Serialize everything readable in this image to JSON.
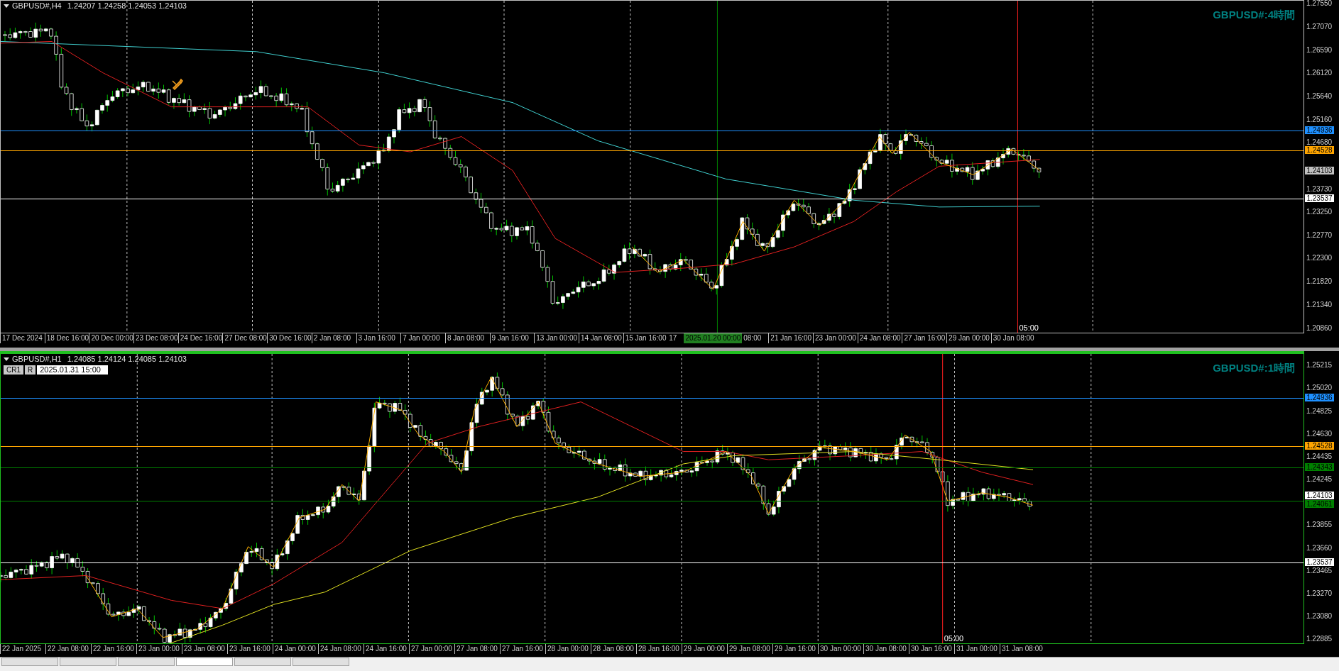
{
  "charts": [
    {
      "kind": "h4",
      "active": false,
      "header": {
        "symbol": "GBPUSD#,H4",
        "quotes": "1.24207 1.24258 1.24053 1.24103"
      },
      "title": "GBPUSD#:4時間",
      "price_ticks": [
        "1.27550",
        "1.27070",
        "1.26590",
        "1.26120",
        "1.25640",
        "1.25160",
        "1.24680",
        "1.23730",
        "1.23250",
        "1.22770",
        "1.22300",
        "1.21820",
        "1.21340",
        "1.20860"
      ],
      "price_lines": [
        {
          "price": "1.24936",
          "kind": "level",
          "color": "#1e90ff"
        },
        {
          "price": "1.24528",
          "kind": "level",
          "color": "#ffa500"
        },
        {
          "price": "1.24103",
          "kind": "bid",
          "color": "#c0c0c0"
        },
        {
          "price": "1.23537",
          "kind": "level",
          "color": "#ffffff"
        }
      ],
      "time_labels": [
        {
          "text": "17 Dec 2024",
          "kind": "tick"
        },
        {
          "text": "18 Dec 16:00",
          "kind": "tick"
        },
        {
          "text": "20 Dec 00:00",
          "kind": "tick"
        },
        {
          "text": "23 Dec 08:00",
          "kind": "tick"
        },
        {
          "text": "24 Dec 16:00",
          "kind": "tick"
        },
        {
          "text": "27 Dec 08:00",
          "kind": "tick"
        },
        {
          "text": "30 Dec 16:00",
          "kind": "tick"
        },
        {
          "text": "2 Jan 08:00",
          "kind": "tick"
        },
        {
          "text": "3 Jan 16:00",
          "kind": "tick"
        },
        {
          "text": "7 Jan 00:00",
          "kind": "tick"
        },
        {
          "text": "8 Jan 08:00",
          "kind": "tick"
        },
        {
          "text": "9 Jan 16:00",
          "kind": "tick"
        },
        {
          "text": "13 Jan 00:00",
          "kind": "tick"
        },
        {
          "text": "14 Jan 08:00",
          "kind": "tick"
        },
        {
          "text": "15 Jan 16:00",
          "kind": "tick"
        },
        {
          "text": "17",
          "kind": "partial"
        },
        {
          "text": "2025.01.20 00:00",
          "kind": "cursor"
        },
        {
          "text": "08:00",
          "kind": "partial"
        },
        {
          "text": "21 Jan 16:00",
          "kind": "tick"
        },
        {
          "text": "23 Jan 00:00",
          "kind": "tick"
        },
        {
          "text": "24 Jan 08:00",
          "kind": "tick"
        },
        {
          "text": "27 Jan 16:00",
          "kind": "tick"
        },
        {
          "text": "29 Jan 00:00",
          "kind": "tick"
        },
        {
          "text": "30 Jan 08:00",
          "kind": "tick"
        }
      ],
      "marker_time": "05:00"
    },
    {
      "kind": "h1",
      "active": true,
      "header": {
        "symbol": "GBPUSD#,H1",
        "quotes": "1.24085 1.24124 1.24085 1.24103"
      },
      "title": "GBPUSD#:1時間",
      "toolbar": {
        "buttons": [
          "CR1",
          "R"
        ],
        "datetime": "2025.01.31 15:00"
      },
      "price_ticks": [
        "1.25215",
        "1.25020",
        "1.24825",
        "1.24630",
        "1.24435",
        "1.24245",
        "1.23855",
        "1.23660",
        "1.23465",
        "1.23270",
        "1.23080",
        "1.22885"
      ],
      "price_lines": [
        {
          "price": "1.24936",
          "kind": "level",
          "color": "#1e90ff"
        },
        {
          "price": "1.24528",
          "kind": "level",
          "color": "#ffa500"
        },
        {
          "price": "1.24343",
          "kind": "level",
          "color": "#008000"
        },
        {
          "price": "1.24103",
          "kind": "bid",
          "color": "#ffffff"
        },
        {
          "price": "1.24061",
          "kind": "level",
          "color": "#008000"
        },
        {
          "price": "1.23537",
          "kind": "level",
          "color": "#ffffff"
        }
      ],
      "time_labels": [
        {
          "text": "22 Jan 2025",
          "kind": "tick"
        },
        {
          "text": "22 Jan 08:00",
          "kind": "tick"
        },
        {
          "text": "22 Jan 16:00",
          "kind": "tick"
        },
        {
          "text": "23 Jan 00:00",
          "kind": "tick"
        },
        {
          "text": "23 Jan 08:00",
          "kind": "tick"
        },
        {
          "text": "23 Jan 16:00",
          "kind": "tick"
        },
        {
          "text": "24 Jan 00:00",
          "kind": "tick"
        },
        {
          "text": "24 Jan 08:00",
          "kind": "tick"
        },
        {
          "text": "24 Jan 16:00",
          "kind": "tick"
        },
        {
          "text": "27 Jan 00:00",
          "kind": "tick"
        },
        {
          "text": "27 Jan 08:00",
          "kind": "tick"
        },
        {
          "text": "27 Jan 16:00",
          "kind": "tick"
        },
        {
          "text": "28 Jan 00:00",
          "kind": "tick"
        },
        {
          "text": "28 Jan 08:00",
          "kind": "tick"
        },
        {
          "text": "28 Jan 16:00",
          "kind": "tick"
        },
        {
          "text": "29 Jan 00:00",
          "kind": "tick"
        },
        {
          "text": "29 Jan 08:00",
          "kind": "tick"
        },
        {
          "text": "29 Jan 16:00",
          "kind": "tick"
        },
        {
          "text": "30 Jan 00:00",
          "kind": "tick"
        },
        {
          "text": "30 Jan 08:00",
          "kind": "tick"
        },
        {
          "text": "30 Jan 16:00",
          "kind": "tick"
        },
        {
          "text": "31 Jan 00:00",
          "kind": "tick"
        },
        {
          "text": "31 Jan 08:00",
          "kind": "tick"
        }
      ],
      "marker_time": "05:00"
    }
  ],
  "tabs": [
    {
      "selected": false
    },
    {
      "selected": false
    },
    {
      "selected": false
    },
    {
      "selected": true
    },
    {
      "selected": false
    },
    {
      "selected": false
    }
  ]
}
